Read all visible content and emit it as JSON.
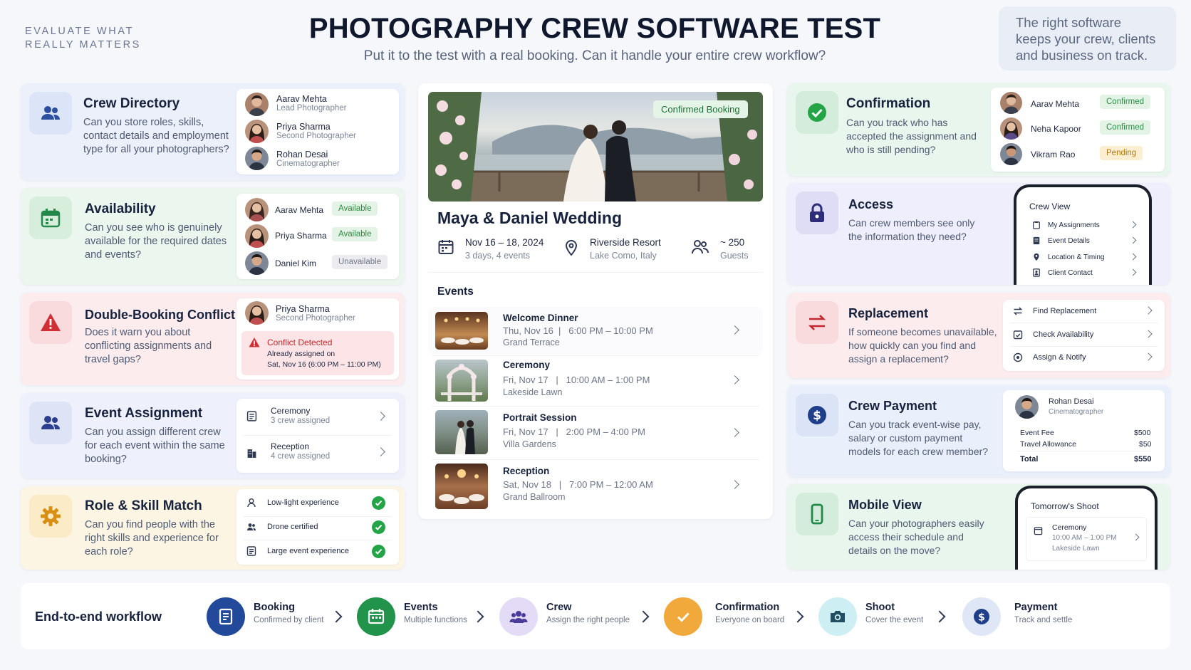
{
  "header": {
    "tagline_line1": "EVALUATE WHAT",
    "tagline_line2": "REALLY MATTERS",
    "title": "PHOTOGRAPHY CREW SOFTWARE TEST",
    "subtitle": "Put it to the test with a real booking. Can it handle your entire crew workflow?",
    "side_note": "The right software keeps your crew, clients and business on track."
  },
  "left": {
    "directory": {
      "title": "Crew Directory",
      "desc": "Can you store roles, skills, contact details and employment type for all your photographers?",
      "people": [
        {
          "name": "Aarav Mehta",
          "role": "Lead Photographer"
        },
        {
          "name": "Priya Sharma",
          "role": "Second Photographer"
        },
        {
          "name": "Rohan Desai",
          "role": "Cinematographer"
        }
      ]
    },
    "availability": {
      "title": "Availability",
      "desc": "Can you see who is genuinely available for the required dates and events?",
      "people": [
        {
          "name": "Aarav Mehta",
          "status": "Available"
        },
        {
          "name": "Priya Sharma",
          "status": "Available"
        },
        {
          "name": "Daniel Kim",
          "status": "Unavailable"
        }
      ]
    },
    "conflict": {
      "title": "Double-Booking Conflict",
      "desc": "Does it warn you about conflicting assignments and travel gaps?",
      "person": {
        "name": "Priya Sharma",
        "role": "Second Photographer"
      },
      "alert_title": "Conflict Detected",
      "alert_line1": "Already assigned on",
      "alert_line2": "Sat, Nov 16 (6:00 PM – 11:00 PM)"
    },
    "assignment": {
      "title": "Event Assignment",
      "desc": "Can you assign different crew for each event within the same booking?",
      "rows": [
        {
          "name": "Ceremony",
          "sub": "3 crew assigned"
        },
        {
          "name": "Reception",
          "sub": "4 crew assigned"
        }
      ]
    },
    "skills": {
      "title": "Role & Skill Match",
      "desc": "Can you find people with the right skills and experience for each role?",
      "rows": [
        "Low-light experience",
        "Drone certified",
        "Large event experience"
      ]
    }
  },
  "center": {
    "badge": "Confirmed Booking",
    "title": "Maya & Daniel Wedding",
    "dates": "Nov 16 – 18, 2024",
    "dates_sub": "3 days, 4 events",
    "venue": "Riverside Resort",
    "venue_sub": "Lake Como, Italy",
    "guests": "~ 250",
    "guests_sub": "Guests",
    "events_label": "Events",
    "events": [
      {
        "name": "Welcome Dinner",
        "day": "Thu, Nov 16",
        "time": "6:00 PM – 10:00 PM",
        "place": "Grand Terrace"
      },
      {
        "name": "Ceremony",
        "day": "Fri, Nov 17",
        "time": "10:00 AM – 1:00 PM",
        "place": "Lakeside Lawn"
      },
      {
        "name": "Portrait Session",
        "day": "Fri, Nov 17",
        "time": "2:00 PM – 4:00 PM",
        "place": "Villa Gardens"
      },
      {
        "name": "Reception",
        "day": "Sat, Nov 18",
        "time": "7:00 PM – 12:00 AM",
        "place": "Grand Ballroom"
      }
    ]
  },
  "right": {
    "confirmation": {
      "title": "Confirmation",
      "desc": "Can you track who has accepted the assignment and who is still pending?",
      "people": [
        {
          "name": "Aarav Mehta",
          "status": "Confirmed"
        },
        {
          "name": "Neha Kapoor",
          "status": "Confirmed"
        },
        {
          "name": "Vikram Rao",
          "status": "Pending"
        }
      ]
    },
    "access": {
      "title": "Access",
      "desc": "Can crew members see only the information they need?",
      "phone_title": "Crew View",
      "items": [
        "My Assignments",
        "Event Details",
        "Location & Timing",
        "Client Contact"
      ]
    },
    "replacement": {
      "title": "Replacement",
      "desc": "If someone becomes unavailable, how quickly can you find and assign a replacement?",
      "items": [
        "Find Replacement",
        "Check Availability",
        "Assign & Notify"
      ]
    },
    "payment": {
      "title": "Crew Payment",
      "desc": "Can you track event-wise pay, salary or custom payment models for each crew member?",
      "person": {
        "name": "Rohan Desai",
        "role": "Cinematographer"
      },
      "lines": [
        {
          "label": "Event Fee",
          "amount": "$500"
        },
        {
          "label": "Travel Allowance",
          "amount": "$50"
        }
      ],
      "total_label": "Total",
      "total_amount": "$550"
    },
    "mobile": {
      "title": "Mobile View",
      "desc": "Can your photographers easily access their schedule and details on the move?",
      "phone_title": "Tomorrow's Shoot",
      "event": "Ceremony",
      "time": "10:00 AM – 1:00 PM",
      "place": "Lakeside Lawn"
    }
  },
  "workflow": {
    "label": "End-to-end workflow",
    "steps": [
      {
        "title": "Booking",
        "sub": "Confirmed by client",
        "color": "#234a9a"
      },
      {
        "title": "Events",
        "sub": "Multiple functions",
        "color": "#22934a"
      },
      {
        "title": "Crew",
        "sub": "Assign the right people",
        "color": "#e4dcf6"
      },
      {
        "title": "Confirmation",
        "sub": "Everyone on board",
        "color": "#f2a93b"
      },
      {
        "title": "Shoot",
        "sub": "Cover the event",
        "color": "#cdeef2"
      },
      {
        "title": "Payment",
        "sub": "Track and settle",
        "color": "#dfe6f6"
      }
    ]
  }
}
